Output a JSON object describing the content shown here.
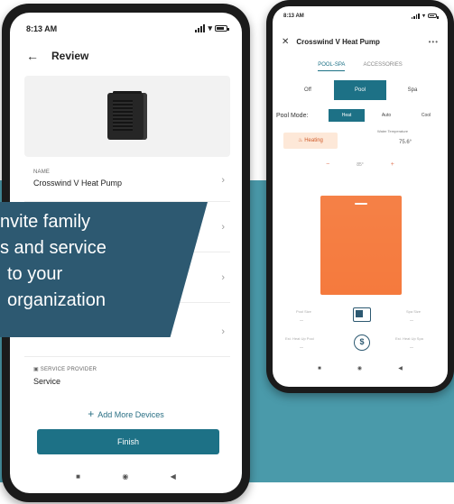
{
  "phone_left": {
    "status": {
      "time": "8:13 AM"
    },
    "header": {
      "title": "Review"
    },
    "fields": [
      {
        "label": "NAME",
        "value": "Crosswind V Heat Pump"
      },
      {
        "label": "",
        "value": ""
      },
      {
        "label": "",
        "value": ""
      },
      {
        "label": "",
        "value": ""
      },
      {
        "label": "SERVICE PROVIDER",
        "value": "Service"
      }
    ],
    "add_more_label": "Add More Devices",
    "finish_label": "Finish"
  },
  "banner": {
    "lines": [
      "nvite family",
      "s and service",
      "to your",
      "organization"
    ]
  },
  "phone_right": {
    "status": {
      "time": "8:13 AM"
    },
    "header": {
      "title": "Crosswind V Heat Pump",
      "more": "•••"
    },
    "tabs": [
      {
        "label": "POOL-SPA",
        "active": true
      },
      {
        "label": "ACCESSORIES",
        "active": false
      }
    ],
    "body_modes": [
      {
        "label": "Off",
        "active": false
      },
      {
        "label": "Pool",
        "active": true
      },
      {
        "label": "Spa",
        "active": false
      }
    ],
    "pool_mode": {
      "label": "Pool Mode:",
      "options": [
        {
          "label": "Heat",
          "active": true
        },
        {
          "label": "Auto",
          "active": false
        },
        {
          "label": "Cool",
          "active": false
        }
      ]
    },
    "heating_label": "Heating",
    "water_temp": {
      "label": "Water Temperature",
      "value": "75.6°"
    },
    "setpoint": {
      "minus": "−",
      "value": "85°",
      "plus": "+"
    },
    "stats": {
      "pool_size_label": "Pool Size",
      "spa_size_label": "Spa Size",
      "est_pool_label": "Est. Heat Up Pool",
      "est_spa_label": "Est. Heat Up Spa",
      "placeholder": "--"
    }
  },
  "colors": {
    "teal": "#1d7186",
    "banner": "#2d5971",
    "background": "#4a9aaa",
    "orange": "#f57a3d"
  }
}
